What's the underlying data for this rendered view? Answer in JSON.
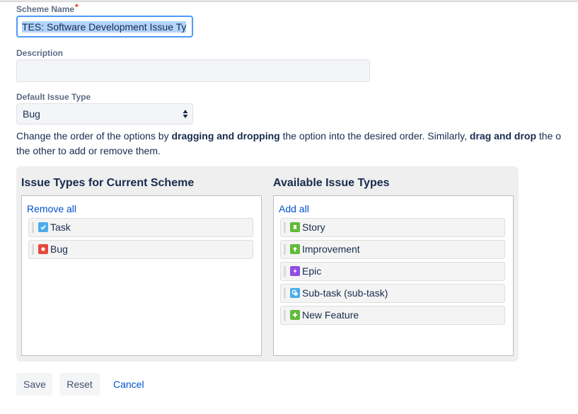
{
  "form": {
    "scheme_name": {
      "label": "Scheme Name",
      "required_marker": "*",
      "value": "TES: Software Development Issue Ty"
    },
    "description": {
      "label": "Description",
      "value": ""
    },
    "default_issue_type": {
      "label": "Default Issue Type",
      "selected": "Bug"
    },
    "help_text": {
      "part1": "Change the order of the options by ",
      "bold1": "dragging and dropping",
      "part2": " the option into the desired order. Similarly, ",
      "bold2": "drag and drop",
      "part3": " the o",
      "line2": "the other to add or remove them."
    }
  },
  "current": {
    "title": "Issue Types for Current Scheme",
    "action": "Remove all",
    "items": [
      {
        "label": "Task",
        "icon": "task-icon",
        "color": "#4bade8"
      },
      {
        "label": "Bug",
        "icon": "bug-icon",
        "color": "#e5493a"
      }
    ]
  },
  "available": {
    "title": "Available Issue Types",
    "action": "Add all",
    "items": [
      {
        "label": "Story",
        "icon": "story-icon",
        "color": "#63ba3c"
      },
      {
        "label": "Improvement",
        "icon": "improvement-icon",
        "color": "#63ba3c"
      },
      {
        "label": "Epic",
        "icon": "epic-icon",
        "color": "#904ee2"
      },
      {
        "label": "Sub-task (sub-task)",
        "icon": "subtask-icon",
        "color": "#4bade8"
      },
      {
        "label": "New Feature",
        "icon": "new-feature-icon",
        "color": "#63ba3c"
      }
    ]
  },
  "buttons": {
    "save": "Save",
    "reset": "Reset",
    "cancel": "Cancel"
  }
}
